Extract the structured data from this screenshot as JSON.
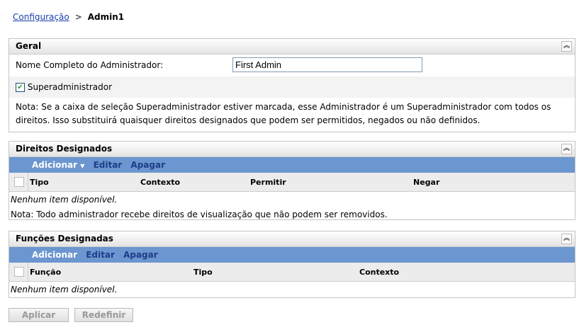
{
  "breadcrumb": {
    "parent": "Configuração",
    "separator": ">",
    "current": "Admin1"
  },
  "geral": {
    "title": "Geral",
    "name_label": "Nome Completo do Administrador:",
    "name_value": "First Admin",
    "superadmin_label": "Superadministrador",
    "superadmin_checked": true,
    "note": "Nota: Se a caixa de seleção Superadministrador estiver marcada, esse Administrador é um Superadministrador com todos os direitos. Isso substituirá quaisquer direitos designados que podem ser permitidos, negados ou não definidos."
  },
  "direitos": {
    "title": "Direitos Designados",
    "toolbar": {
      "add": "Adicionar",
      "edit": "Editar",
      "delete": "Apagar"
    },
    "columns": [
      "Tipo",
      "Contexto",
      "Permitir",
      "Negar"
    ],
    "empty": "Nenhum item disponível.",
    "note": "Nota: Todo administrador recebe direitos de visualização que não podem ser removidos."
  },
  "funcoes": {
    "title": "Funções Designadas",
    "toolbar": {
      "add": "Adicionar",
      "edit": "Editar",
      "delete": "Apagar"
    },
    "columns": [
      "Função",
      "Tipo",
      "Contexto"
    ],
    "empty": "Nenhum item disponível."
  },
  "buttons": {
    "apply": "Aplicar",
    "reset": "Redefinir"
  }
}
